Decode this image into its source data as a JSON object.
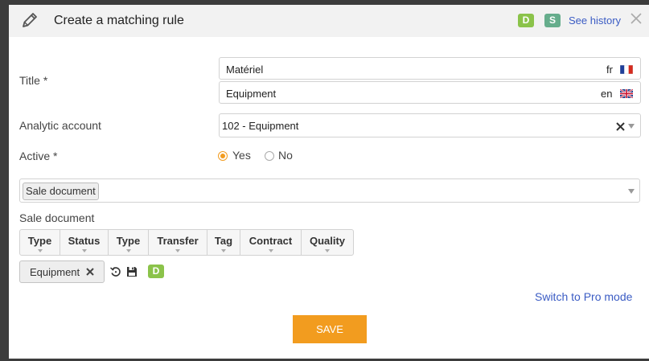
{
  "dialog": {
    "title": "Create a matching rule",
    "badges": [
      "D",
      "S"
    ],
    "see_history": "See history"
  },
  "form": {
    "title_label": "Title *",
    "title_fr": {
      "value": "Matériel",
      "lang": "fr"
    },
    "title_en": {
      "value": "Equipment",
      "lang": "en"
    },
    "analytic_label": "Analytic account",
    "analytic_value": "102 - Equipment",
    "active_label": "Active *",
    "active_options": [
      "Yes",
      "No"
    ],
    "active_selected": "Yes"
  },
  "document_type": {
    "selected_tag": "Sale document",
    "section_label": "Sale document",
    "filter_columns": [
      "Type",
      "Status",
      "Type",
      "Transfer",
      "Tag",
      "Contract",
      "Quality"
    ]
  },
  "filter_chip": {
    "label": "Equipment",
    "badge": "D"
  },
  "footer": {
    "pro_mode": "Switch to Pro mode",
    "save": "SAVE"
  },
  "colors": {
    "accent": "#f29c1f",
    "badge_d": "#8bc34a",
    "badge_s": "#66ad8c",
    "link": "#3b5cc4"
  }
}
